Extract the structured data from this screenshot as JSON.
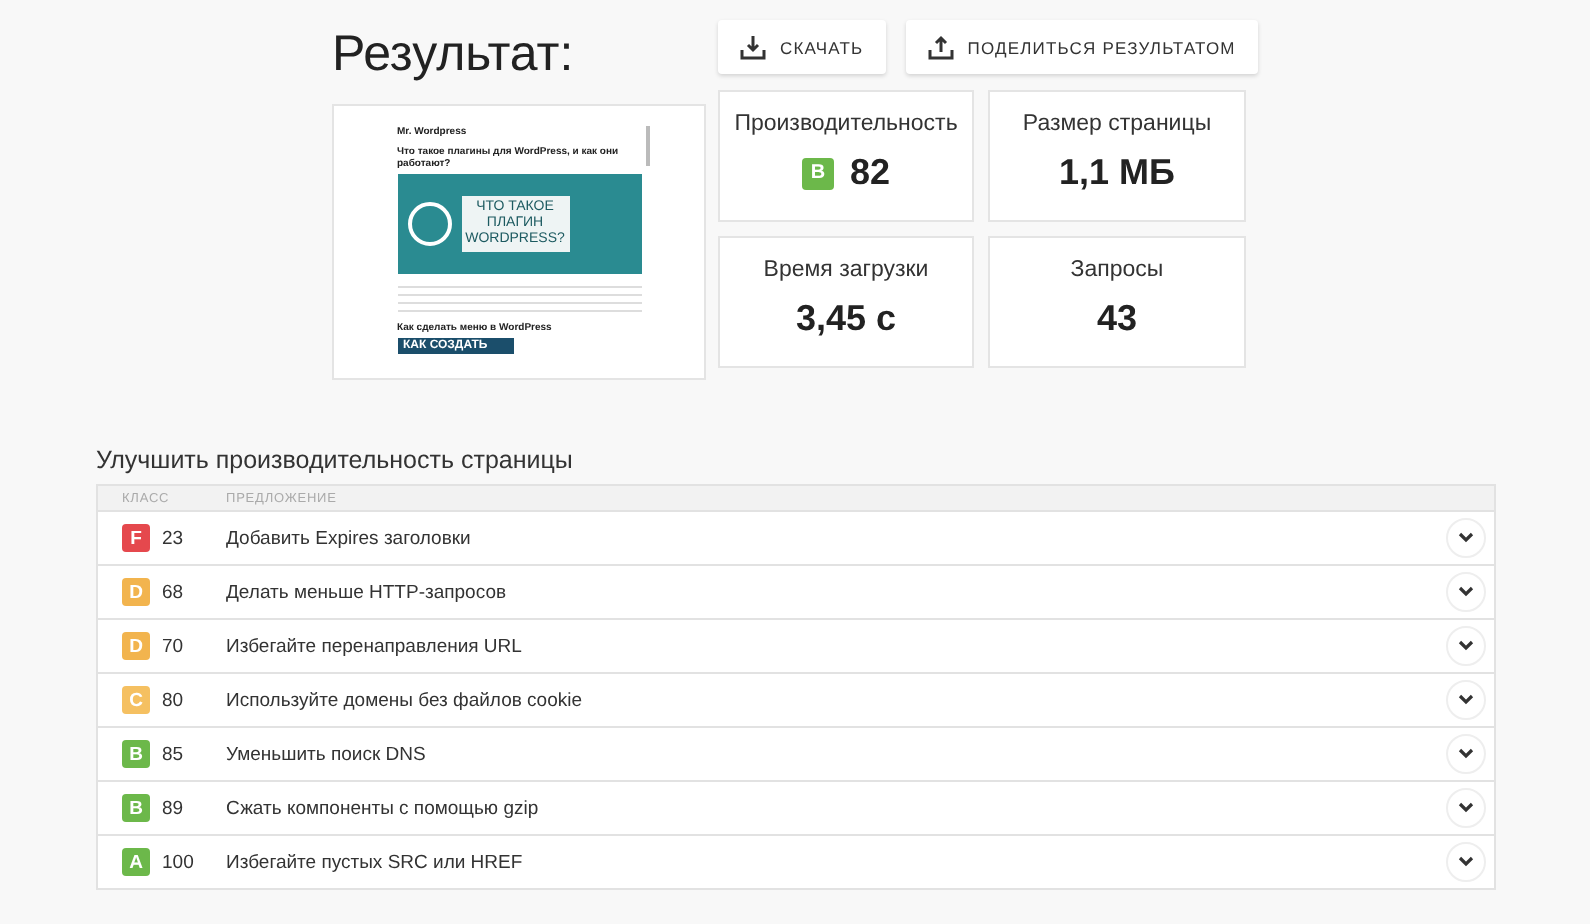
{
  "title": "Результат:",
  "actions": [
    {
      "kind": "download",
      "label": "СКАЧАТЬ"
    },
    {
      "kind": "share",
      "label": "ПОДЕЛИТЬСЯ РЕЗУЛЬТАТОМ"
    }
  ],
  "preview": {
    "site": "Mr. Wordpress",
    "headline": "Что такое плагины для WordPress, и как они работают?",
    "banner": "ЧТО ТАКОЕ ПЛАГИН WORDPRESS?",
    "next_headline": "Как сделать меню в WordPress",
    "next_banner": "КАК СОЗДАТЬ"
  },
  "metrics": [
    {
      "label": "Производительность",
      "value": "82",
      "grade": "B",
      "color": "#6cb84a"
    },
    {
      "label": "Размер страницы",
      "value": "1,1 МБ"
    },
    {
      "label": "Время загрузки",
      "value": "3,45 с"
    },
    {
      "label": "Запросы",
      "value": "43"
    }
  ],
  "section_title": "Улучшить производительность страницы",
  "table": {
    "columns": [
      "КЛАСС",
      "ПРЕДЛОЖЕНИЕ"
    ],
    "rows": [
      {
        "grade": "F",
        "score": "23",
        "text": "Добавить Expires заголовки",
        "color": "#e5484d",
        "expanded": false
      },
      {
        "grade": "D",
        "score": "68",
        "text": "Делать меньше HTTP-запросов",
        "color": "#f2b44e",
        "expanded": false
      },
      {
        "grade": "D",
        "score": "70",
        "text": "Избегайте перенаправления URL",
        "color": "#f2b44e",
        "expanded": false
      },
      {
        "grade": "C",
        "score": "80",
        "text": "Используйте домены без файлов cookie",
        "color": "#f5c061",
        "expanded": false
      },
      {
        "grade": "B",
        "score": "85",
        "text": "Уменьшить поиск DNS",
        "color": "#6cb84a",
        "expanded": false
      },
      {
        "grade": "B",
        "score": "89",
        "text": "Сжать компоненты с помощью gzip",
        "color": "#6cb84a",
        "expanded": false
      },
      {
        "grade": "A",
        "score": "100",
        "text": "Избегайте пустых SRC или HREF",
        "color": "#6cb84a",
        "expanded": false
      }
    ]
  }
}
